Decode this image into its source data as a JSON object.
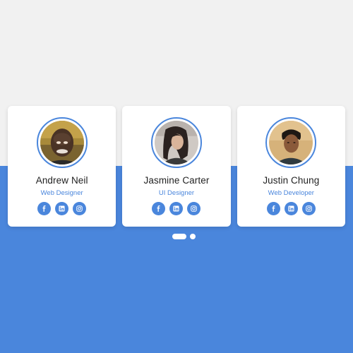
{
  "theme": {
    "accent": "#4a86dc",
    "background_top": "#f1f1f1",
    "background_bottom": "#4a86dc"
  },
  "team": [
    {
      "name": "Andrew Neil",
      "role": "Web Designer",
      "socials": [
        "facebook-icon",
        "linkedin-icon",
        "instagram-icon"
      ]
    },
    {
      "name": "Jasmine Carter",
      "role": "UI Designer",
      "socials": [
        "facebook-icon",
        "linkedin-icon",
        "instagram-icon"
      ]
    },
    {
      "name": "Justin Chung",
      "role": "Web Developer",
      "socials": [
        "facebook-icon",
        "linkedin-icon",
        "instagram-icon"
      ]
    }
  ],
  "pagination": {
    "pages": 2,
    "active": 1
  }
}
